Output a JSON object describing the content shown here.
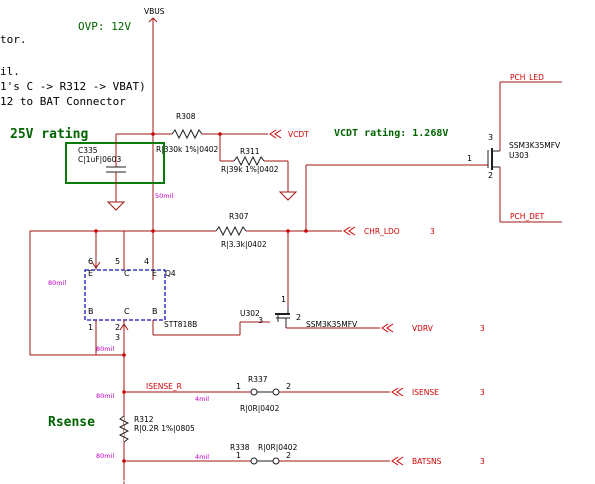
{
  "notes": {
    "ovp": "OVP: 12V",
    "frag_tor": "tor.",
    "frag_il": "il.",
    "frag_path": "1's C -> R312 -> VBAT)",
    "frag_conn": "12 to BAT Connector",
    "rating_25v": "25V rating",
    "vcdt_rating": "VCDT rating: 1.268V",
    "rsense": "Rsense"
  },
  "rails": {
    "vbus": "VBUS"
  },
  "components": {
    "r308": {
      "ref": "R308",
      "value": "R|330k 1%|0402"
    },
    "r311": {
      "ref": "R311",
      "value": "R|39k 1%|0402"
    },
    "r307": {
      "ref": "R307",
      "value": "R|3.3k|0402"
    },
    "c335": {
      "ref": "C335",
      "value": "C|1uF|0603"
    },
    "q4": {
      "ref": "Q4",
      "part": "STT818B"
    },
    "u302": {
      "ref": "U302",
      "part": "SSM3K35MFV"
    },
    "u303": {
      "ref": "U303",
      "part": "SSM3K35MFV"
    },
    "r337": {
      "ref": "R337",
      "value": "R|0R|0402"
    },
    "r338": {
      "ref": "R338",
      "value": "R|0R|0402"
    },
    "r312": {
      "ref": "R312",
      "value": "R|0.2R 1%|0805"
    }
  },
  "nets": {
    "vcdt": "VCDT",
    "chr_ldo": "CHR_LDO",
    "vdrv": "VDRV",
    "isense": "ISENSE",
    "batsns": "BATSNS",
    "pch_led": "PCH_LED",
    "pch_det": "PCH_DET",
    "isense_r": "ISENSE_R",
    "sheet_ref": "3"
  },
  "widths": {
    "w50": "50mil",
    "w80": "80mil",
    "w4": "4mil"
  },
  "pins": {
    "p1": "1",
    "p2": "2",
    "p3": "3",
    "p4": "4",
    "p5": "5",
    "p6": "6",
    "B": "B",
    "C": "C",
    "E": "E"
  }
}
